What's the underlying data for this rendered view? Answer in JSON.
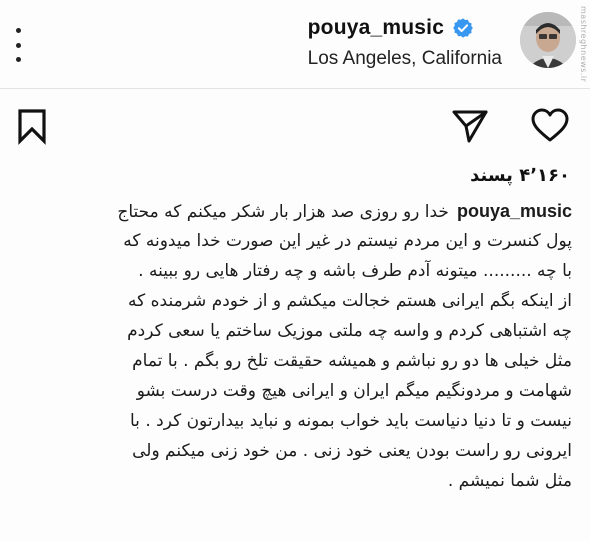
{
  "header": {
    "username": "pouya_music",
    "location": "Los Angeles, California",
    "icons": {
      "more": "more-vertical-icon",
      "verified": "verified-badge-icon",
      "avatar": "avatar"
    },
    "watermark": "mashreghnews.ir"
  },
  "actions": {
    "icons": [
      "bookmark-icon",
      "send-icon",
      "heart-icon"
    ]
  },
  "likes": {
    "text": "۴٬۱۶۰ پسند"
  },
  "caption": {
    "username": "pouya_music",
    "first_line_text": "خدا رو روزی صد هزار بار شکر میکنم که محتاج",
    "lines": [
      "پول کنسرت و این مردم نیستم در غیر این صورت خدا میدونه که",
      "با چه ......... میتونه آدم طرف باشه و چه رفتار هایی رو ببینه .",
      "از اینکه بگم ایرانی هستم خجالت میکشم و از خودم شرمنده که",
      "چه اشتباهی کردم و واسه چه ملتی موزیک ساختم یا سعی کردم",
      "مثل خیلی ها دو رو نباشم و همیشه حقیقت تلخ رو بگم . با تمام",
      "شهامت و مردونگیم میگم ایران و ایرانی هیچ وقت درست بشو",
      "نیست و تا دنیا دنیاست باید خواب بمونه و نباید بیدارتون کرد . با",
      "ایرونی رو راست بودن یعنی خود زنی . من خود زنی میکنم ولی",
      "مثل شما نمیشم ."
    ]
  },
  "colors": {
    "verified": "#3897f0",
    "text": "#1c1c1c",
    "background": "#fdfdfd"
  }
}
